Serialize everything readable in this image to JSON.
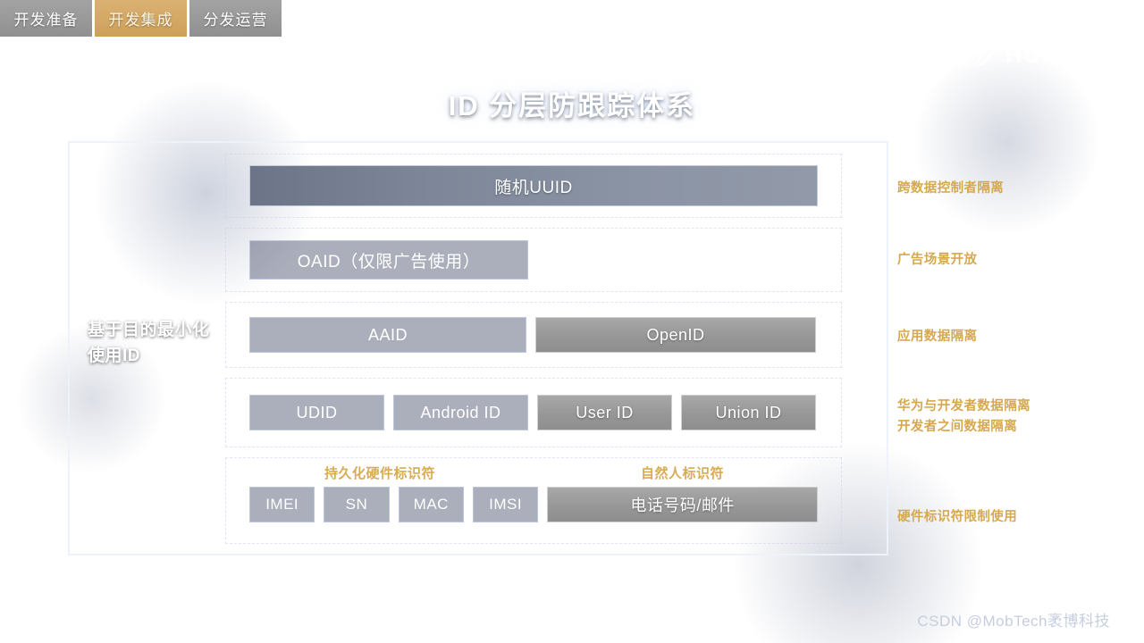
{
  "tabs": [
    {
      "label": "开发准备",
      "state": "inactive"
    },
    {
      "label": "开发集成",
      "state": "active"
    },
    {
      "label": "分发运营",
      "state": "inactive"
    }
  ],
  "brand": {
    "name": "HUAWEI",
    "logo_icon": "huawei-flower-logo-icon"
  },
  "title": "ID 分层防跟踪体系",
  "diagram": {
    "left_label": "基于目的最小化使用ID",
    "rows": [
      {
        "id": "row-uuid",
        "chips": [
          {
            "label": "随机UUID",
            "style": "bluegrey"
          }
        ]
      },
      {
        "id": "row-oaid",
        "chips": [
          {
            "label": "OAID（仅限广告使用）",
            "style": "outline"
          }
        ]
      },
      {
        "id": "row-app",
        "chips": [
          {
            "label": "AAID",
            "style": "outline"
          },
          {
            "label": "OpenID",
            "style": "grey"
          }
        ]
      },
      {
        "id": "row-device",
        "chips": [
          {
            "label": "UDID",
            "style": "outline"
          },
          {
            "label": "Android ID",
            "style": "outline"
          },
          {
            "label": "User ID",
            "style": "grey"
          },
          {
            "label": "Union ID",
            "style": "grey"
          }
        ]
      },
      {
        "id": "row-hardware",
        "subheads": [
          "持久化硬件标识符",
          "自然人标识符"
        ],
        "chips": [
          {
            "label": "IMEI",
            "style": "outline"
          },
          {
            "label": "SN",
            "style": "outline"
          },
          {
            "label": "MAC",
            "style": "outline"
          },
          {
            "label": "IMSI",
            "style": "outline"
          },
          {
            "label": "电话号码/邮件",
            "style": "grey"
          }
        ]
      }
    ]
  },
  "notes": [
    "跨数据控制者隔离",
    "广告场景开放",
    "应用数据隔离",
    "华为与开发者数据隔离",
    "开发者之间数据隔离",
    "硬件标识符限制使用"
  ],
  "watermark": "CSDN @MobTech袤博科技",
  "colors": {
    "background_deep": "#0a1028",
    "accent_gold": "#d6a84f",
    "tab_active": "#cda059",
    "tab_inactive": "#949494",
    "frame_border": "#eef2fb",
    "chip_grey": "#979797",
    "chip_bluegrey": "#838c9d"
  }
}
